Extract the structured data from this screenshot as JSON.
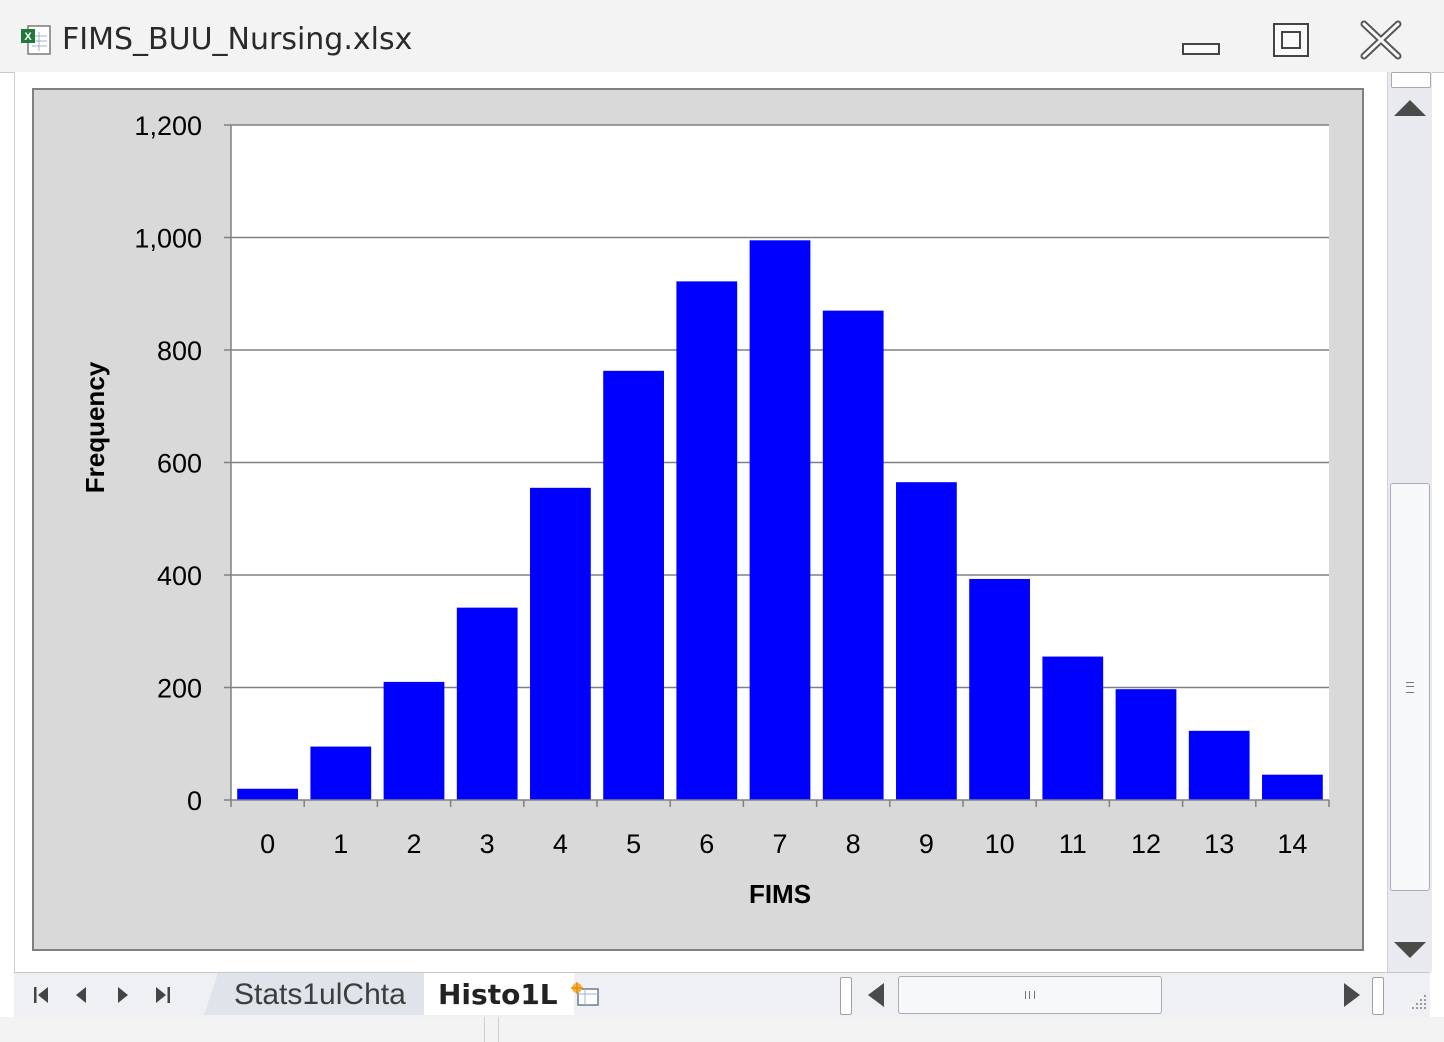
{
  "window": {
    "title": "FIMS_BUU_Nursing.xlsx",
    "app_icon": "excel-file-icon"
  },
  "sheet_tabs": [
    {
      "label": "Stats1ulChta",
      "active": false
    },
    {
      "label": "Histo1L",
      "active": true
    }
  ],
  "colors": {
    "bar": "#0000ff",
    "plot_bg": "#ffffff",
    "chart_bg": "#d9d9d9",
    "gridline": "#808080"
  },
  "chart_data": {
    "type": "bar",
    "title": "",
    "xlabel": "FIMS",
    "ylabel": "Frequency",
    "categories": [
      "0",
      "1",
      "2",
      "3",
      "4",
      "5",
      "6",
      "7",
      "8",
      "9",
      "10",
      "11",
      "12",
      "13",
      "14"
    ],
    "values": [
      20,
      95,
      210,
      342,
      555,
      763,
      922,
      995,
      870,
      565,
      393,
      255,
      197,
      123,
      45
    ],
    "ylim": [
      0,
      1200
    ],
    "yticks": [
      0,
      200,
      400,
      600,
      800,
      1000,
      1200
    ],
    "ytick_labels": [
      "0",
      "200",
      "400",
      "600",
      "800",
      "1,000",
      "1,200"
    ],
    "grid": true,
    "legend": "none"
  }
}
